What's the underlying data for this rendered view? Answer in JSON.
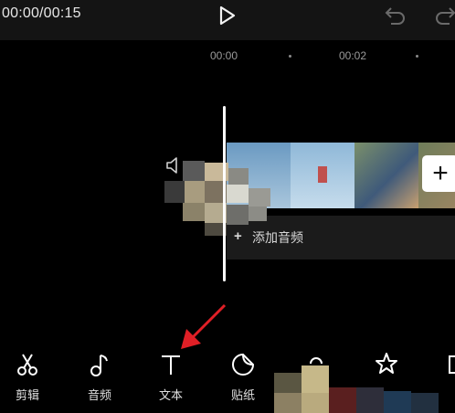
{
  "timecode": "00:00/00:15",
  "ruler": {
    "label_0": "00:00",
    "label_2": "00:02"
  },
  "audio_track": {
    "plus": "+",
    "label": "添加音频"
  },
  "add_clip": {
    "symbol": "+"
  },
  "toolbar": {
    "items": [
      {
        "label": "剪辑",
        "icon": "scissors-icon"
      },
      {
        "label": "音频",
        "icon": "music-note-icon"
      },
      {
        "label": "文本",
        "icon": "text-icon"
      },
      {
        "label": "贴纸",
        "icon": "sticker-icon"
      },
      {
        "label": "",
        "icon": "effects-icon"
      },
      {
        "label": "",
        "icon": "star-icon"
      },
      {
        "label": "",
        "icon": "more-icon"
      }
    ]
  },
  "colors": {
    "accent_arrow": "#e01f26",
    "background": "#000000",
    "audio_row": "#1b1b1b"
  }
}
